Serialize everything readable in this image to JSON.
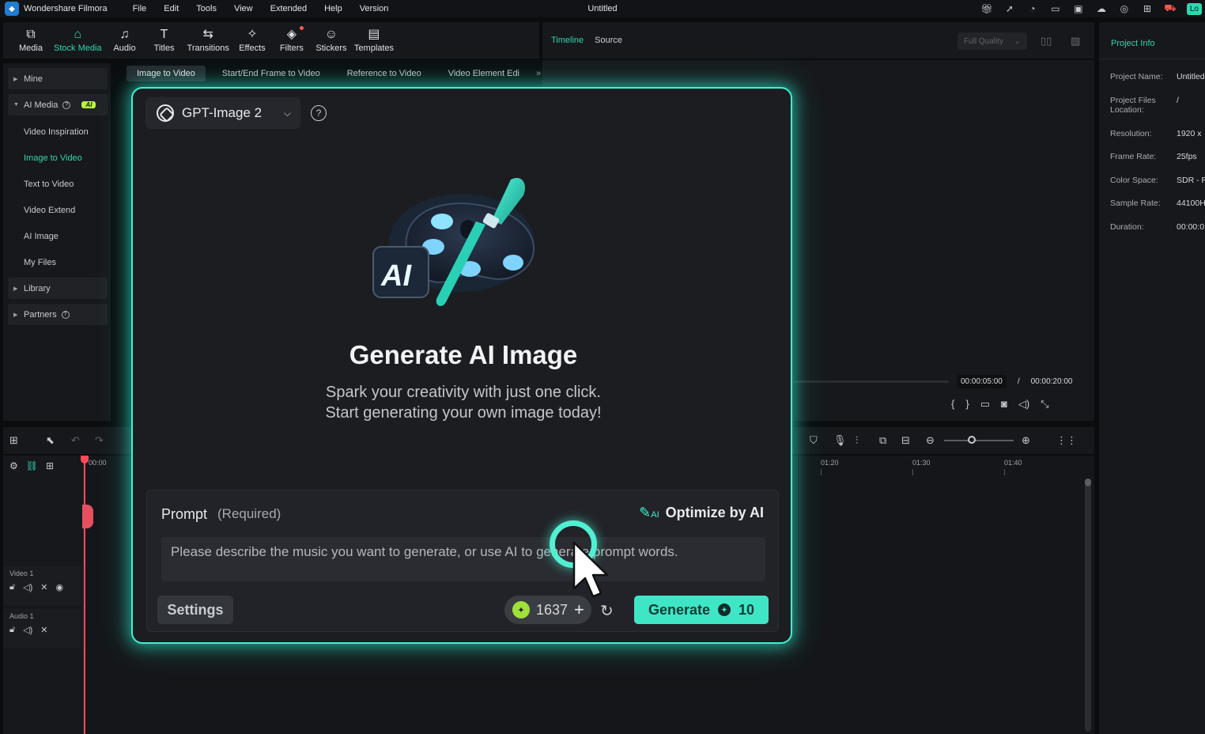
{
  "titlebar": {
    "app_name": "Wondershare Filmora",
    "menu": [
      "File",
      "Edit",
      "Tools",
      "View",
      "Extended",
      "Help",
      "Version"
    ],
    "doc_title": "Untitled",
    "login_label": "Lo"
  },
  "toolbar": {
    "items": [
      {
        "label": "Media",
        "icon": "media-icon"
      },
      {
        "label": "Stock Media",
        "icon": "stock-media-icon"
      },
      {
        "label": "Audio",
        "icon": "audio-icon"
      },
      {
        "label": "Titles",
        "icon": "titles-icon"
      },
      {
        "label": "Transitions",
        "icon": "transitions-icon"
      },
      {
        "label": "Effects",
        "icon": "effects-icon"
      },
      {
        "label": "Filters",
        "icon": "filters-icon"
      },
      {
        "label": "Stickers",
        "icon": "stickers-icon"
      },
      {
        "label": "Templates",
        "icon": "templates-icon"
      }
    ],
    "active": "Stock Media"
  },
  "sidebar": {
    "mine": "Mine",
    "ai_media": "AI Media",
    "ai_badge": "AI",
    "items": [
      "Video Inspiration",
      "Image to Video",
      "Text to Video",
      "Video Extend",
      "AI Image",
      "My Files"
    ],
    "active_item": "Image to Video",
    "library": "Library",
    "partners": "Partners"
  },
  "subtabs": {
    "items": [
      "Image to Video",
      "Start/End Frame to Video",
      "Reference to Video",
      "Video Element Edi"
    ],
    "active": "Image to Video"
  },
  "player": {
    "tab_timeline": "Timeline",
    "tab_source": "Source",
    "quality": "Full Quality",
    "current_time": "00:00:05:00",
    "separator": "/",
    "total_time": "00:00:20:00"
  },
  "project_info": {
    "title": "Project Info",
    "rows": [
      {
        "label": "Project Name:",
        "value": "Untitled"
      },
      {
        "label": "Project Files Location:",
        "value": "/"
      },
      {
        "label": "Resolution:",
        "value": "1920 x"
      },
      {
        "label": "Frame Rate:",
        "value": "25fps"
      },
      {
        "label": "Color Space:",
        "value": "SDR - R"
      },
      {
        "label": "Sample Rate:",
        "value": "44100H"
      },
      {
        "label": "Duration:",
        "value": "00:00:0"
      }
    ]
  },
  "timeline": {
    "ruler_start": "00:00",
    "ruler": [
      "01:20",
      "01:30",
      "01:40"
    ],
    "tracks": [
      {
        "name": "Video 1"
      },
      {
        "name": "Audio 1"
      }
    ]
  },
  "modal": {
    "model": "GPT-Image 2",
    "hero_badge": "AI",
    "title": "Generate AI Image",
    "subtitle_line1": "Spark your creativity with just one click.",
    "subtitle_line2": "Start generating your own image today!",
    "prompt_label": "Prompt",
    "prompt_required": "(Required)",
    "optimize_label": "Optimize by AI",
    "optimize_icon_text": "AI",
    "prompt_placeholder": "Please describe the music you want to generate, or use AI to generate prompt words.",
    "settings_label": "Settings",
    "credits": "1637",
    "generate_label": "Generate",
    "generate_cost": "10"
  },
  "colors": {
    "accent": "#2fd6b2",
    "modal_border": "#3ff1d3",
    "generate_bg": "#3fe6c6",
    "playhead": "#ff4a5a"
  }
}
